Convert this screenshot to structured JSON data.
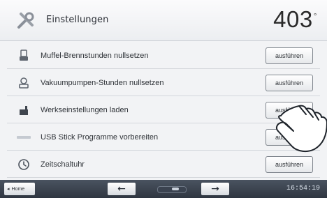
{
  "header": {
    "title": "Einstellungen",
    "temperature": "403",
    "temperature_unit": "°"
  },
  "rows": [
    {
      "label": "Muffel-Brennstunden nullsetzen",
      "icon": "furnace-icon",
      "button": "ausführen"
    },
    {
      "label": "Vakuumpumpen-Stunden nullsetzen",
      "icon": "pump-icon",
      "button": "ausführen"
    },
    {
      "label": "Werkseinstellungen laden",
      "icon": "factory-icon",
      "button": "ausführen"
    },
    {
      "label": "USB Stick Programme vorbereiten",
      "icon": "usb-icon",
      "button": "ausführen"
    },
    {
      "label": "Zeitschaltuhr",
      "icon": "timer-icon",
      "button": "ausführen"
    }
  ],
  "footer": {
    "home_label": "Home",
    "left_arrow": "←",
    "right_arrow": "→",
    "time": "16:54:19"
  }
}
